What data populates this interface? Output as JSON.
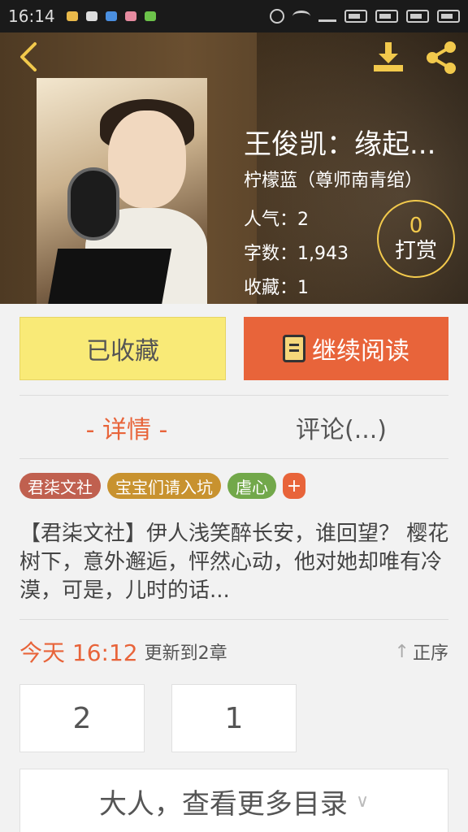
{
  "status_bar": {
    "time": "16:14"
  },
  "book": {
    "title": "王俊凯：缘起...",
    "author": "柠檬蓝（尊师南青绾）",
    "popularity": "人气：2",
    "word_count": "字数：1,943",
    "favorites": "收藏：1",
    "reward_count": "0",
    "reward_label": "打赏"
  },
  "actions": {
    "collected_label": "已收藏",
    "continue_label": "继续阅读"
  },
  "tabs": [
    {
      "label": "- 详情 -"
    },
    {
      "label": "评论(...)"
    }
  ],
  "tags": [
    {
      "label": "君柒文社",
      "color": "#c0604f"
    },
    {
      "label": "宝宝们请入坑",
      "color": "#c8922f"
    },
    {
      "label": "虐心",
      "color": "#72a84a"
    }
  ],
  "tag_add": "+",
  "intro": "【君柒文社】伊人浅笑醉长安，谁回望？ 樱花树下，意外邂逅，怦然心动，他对她却唯有冷漠，可是，儿时的话...",
  "update": {
    "time": "今天 16:12",
    "text": "更新到2章",
    "sort_label": "正序"
  },
  "chapters": [
    "2",
    "1"
  ],
  "more_label": "大人，查看更多目录",
  "colors": {
    "accent": "#e8643a",
    "collected_bg": "#f9ea77",
    "header_icon": "#f2c94c"
  }
}
